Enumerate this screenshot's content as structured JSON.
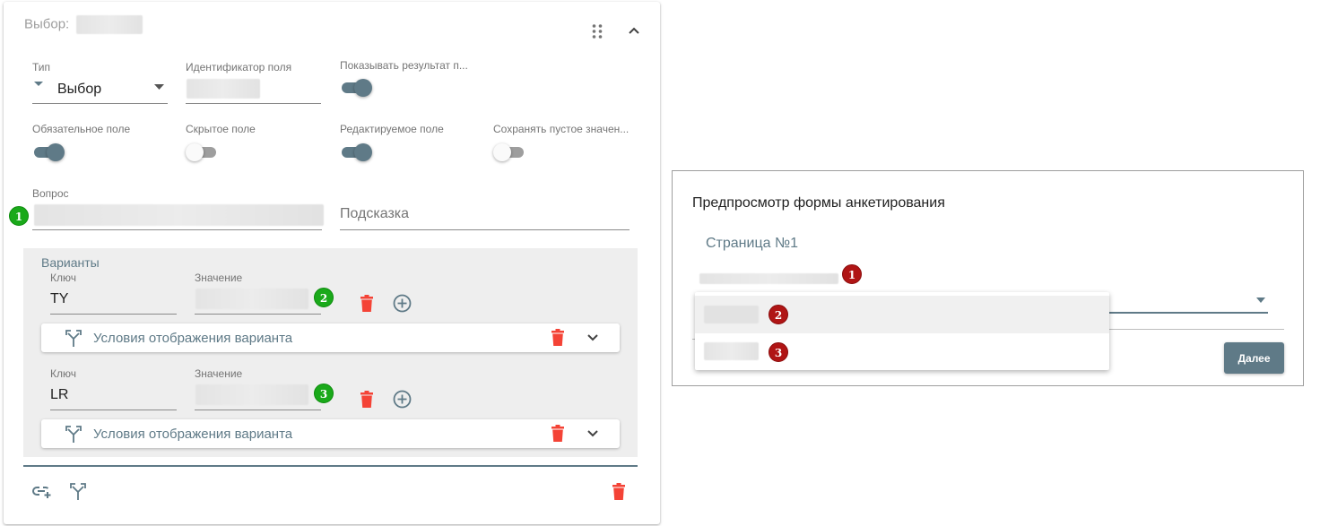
{
  "editor": {
    "title_prefix": "Выбор:",
    "fields": {
      "type_label": "Тип",
      "type_value": "Выбор",
      "id_label": "Идентификатор поля",
      "show_result_label": "Показывать результат п...",
      "required_label": "Обязательное поле",
      "hidden_label": "Скрытое поле",
      "editable_label": "Редактируемое поле",
      "save_empty_label": "Сохранять пустое значен...",
      "question_label": "Вопрос",
      "hint_placeholder": "Подсказка"
    },
    "toggles": {
      "show_result": true,
      "required": true,
      "hidden": false,
      "editable": true,
      "save_empty": false
    },
    "variants": {
      "title": "Варианты",
      "key_label": "Ключ",
      "value_label": "Значение",
      "conditions_label": "Условия отображения варианта",
      "items": [
        {
          "key": "TY",
          "badge": "2"
        },
        {
          "key": "LR",
          "badge": "3"
        }
      ]
    },
    "question_badge": "1"
  },
  "preview": {
    "title": "Предпросмотр формы анкетирования",
    "page_title": "Страница №1",
    "question_badge": "1",
    "options": [
      {
        "badge": "2"
      },
      {
        "badge": "3"
      }
    ],
    "next_label": "Далее"
  },
  "colors": {
    "accent": "#5f7a87",
    "delete": "#f44336",
    "badge_green": "#1aa91a",
    "badge_red": "#b01515"
  }
}
